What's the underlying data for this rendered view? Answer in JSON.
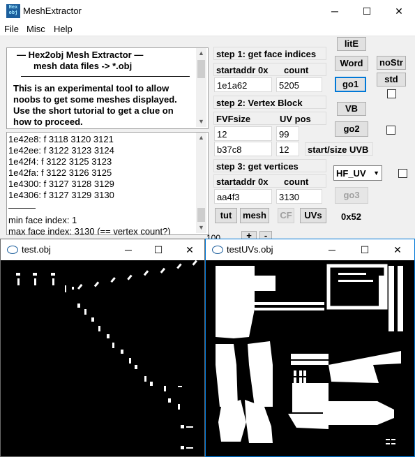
{
  "window": {
    "title": "MeshExtractor",
    "icon_text_top": "Hex",
    "icon_text_bottom": "obj"
  },
  "window_controls": {
    "minimize": "─",
    "maximize": "☐",
    "close": "✕"
  },
  "menu": [
    "File",
    "Misc",
    "Help"
  ],
  "info_panel": {
    "line1": "—   Hex2obj Mesh Extractor   —",
    "line2": "mesh data files -> *.obj",
    "body": [
      "This is an experimental tool to allow",
      "noobs to get some meshes displayed.",
      "Use the short tutorial to get a clue on",
      "how to proceed."
    ]
  },
  "log_panel": {
    "lines": [
      "1e42e8: f  3118 3120 3121",
      "1e42ee: f  3122 3123 3124",
      "1e42f4: f  3122 3125 3123",
      "1e42fa: f  3122 3126 3125",
      "1e4300: f  3127 3128 3129",
      "1e4306: f  3127 3129 3130"
    ],
    "separator": "———",
    "min_face": "min face index: 1",
    "max_face": "max face index: 3130 (== vertex count?)"
  },
  "step1": {
    "heading": "step 1: get face indices",
    "startaddr_label": "startaddr 0x",
    "count_label": "count",
    "startaddr_value": "1e1a62",
    "count_value": "5205"
  },
  "step2": {
    "heading": "step 2: Vertex Block",
    "fvf_label": "FVFsize",
    "uvpos_label": "UV pos",
    "fvf_value": "12",
    "uvpos_value": "99",
    "uvb_start": "b37c8",
    "uvb_size": "12",
    "uvb_label": "start/size UVB"
  },
  "step3": {
    "heading": "step 3: get vertices",
    "startaddr_label": "startaddr 0x",
    "count_label": "count",
    "startaddr_value": "aa4f3",
    "count_value": "3130"
  },
  "buttons": {
    "lite": "litE",
    "word": "Word",
    "go1": "go1",
    "nostr": "noStr",
    "std": "std",
    "vb": "VB",
    "go2": "go2",
    "go3": "go3",
    "tut": "tut",
    "mesh": "mesh",
    "cf": "CF",
    "uvs": "UVs"
  },
  "uv_select": {
    "value": "HF_UV"
  },
  "hex_readout": "0x52",
  "zoom_partial": "100",
  "zoom_plus": "+",
  "zoom_minus": "-",
  "child1": {
    "title": "test.obj"
  },
  "child2": {
    "title": "testUVs.obj"
  },
  "colors": {
    "accent": "#0078d7",
    "canvas": "#000000",
    "mesh": "#ffffff"
  }
}
